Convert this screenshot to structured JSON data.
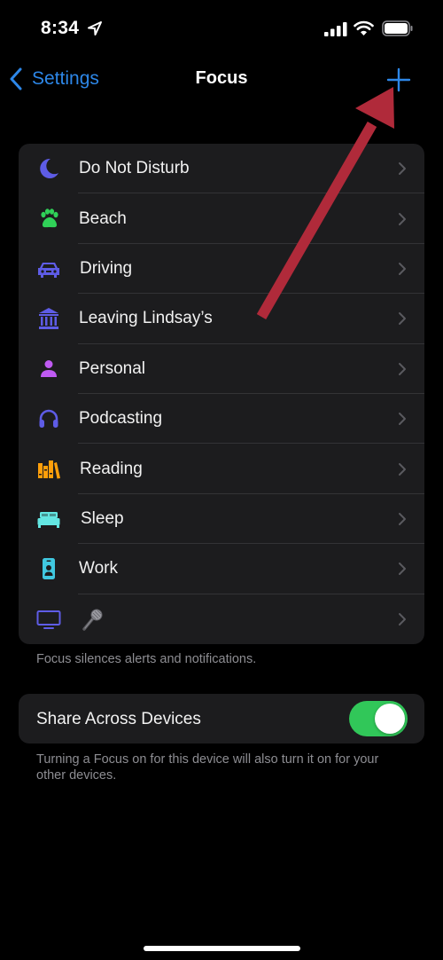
{
  "status_bar": {
    "time": "8:34",
    "icons": [
      "location-arrow-icon",
      "cellular-signal-icon",
      "wifi-icon",
      "battery-icon"
    ]
  },
  "nav": {
    "back_label": "Settings",
    "title": "Focus",
    "add_icon": "plus-icon"
  },
  "focus_list": {
    "items": [
      {
        "label": "Do Not Disturb",
        "icon": "moon-icon",
        "color": "#5e5ce6"
      },
      {
        "label": "Beach",
        "icon": "paw-icon",
        "color": "#30d158"
      },
      {
        "label": "Driving",
        "icon": "car-icon",
        "color": "#5e5ce6"
      },
      {
        "label": "Leaving Lindsay’s",
        "icon": "building-columns-icon",
        "color": "#5e5ce6"
      },
      {
        "label": "Personal",
        "icon": "person-icon",
        "color": "#bf5af2"
      },
      {
        "label": "Podcasting",
        "icon": "headphones-icon",
        "color": "#5e5ce6"
      },
      {
        "label": "Reading",
        "icon": "books-icon",
        "color": "#ff9f0a"
      },
      {
        "label": "Sleep",
        "icon": "bed-icon",
        "color": "#63e6e2"
      },
      {
        "label": "Work",
        "icon": "id-badge-icon",
        "color": "#40c8e0"
      },
      {
        "label": "",
        "icon": "tv-icon",
        "color": "#5e5ce6",
        "extra_icon": "microphone-emoji-icon"
      }
    ],
    "footer": "Focus silences alerts and notifications."
  },
  "share": {
    "label": "Share Across Devices",
    "enabled": true,
    "footer": "Turning a Focus on for this device will also turn it on for your other devices."
  },
  "colors": {
    "accent": "#2d87e8",
    "toggle_on": "#31c759",
    "annotation_arrow": "#b02a3a",
    "group_bg": "#1c1c1e"
  }
}
